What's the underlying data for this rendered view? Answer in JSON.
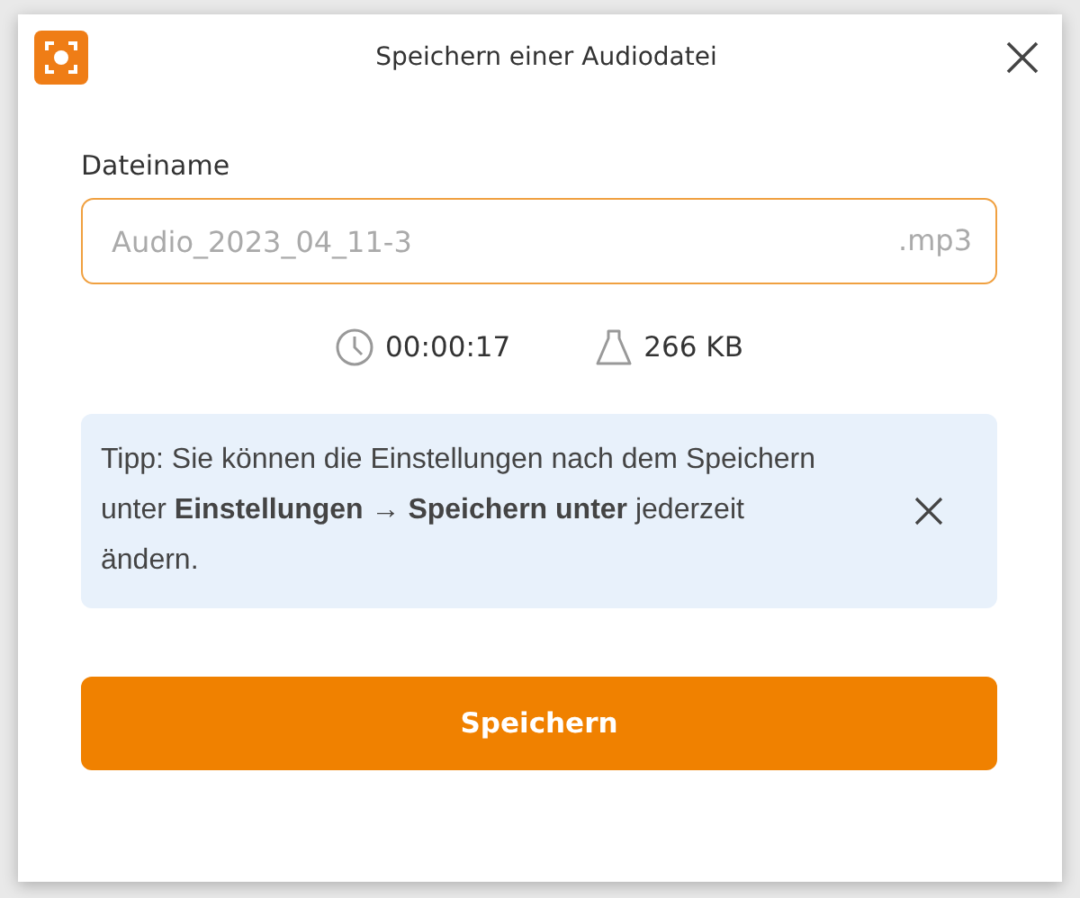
{
  "window": {
    "title": "Speichern einer Audiodatei"
  },
  "filename": {
    "label": "Dateiname",
    "placeholder": "Audio_2023_04_11-3",
    "extension": ".mp3"
  },
  "info": {
    "duration": "00:00:17",
    "size": "266 KB"
  },
  "tip": {
    "text": "Tipp: Sie können die Einstellungen nach dem Speichern unter **Einstellungen → Speichern unter** jederzeit ändern."
  },
  "buttons": [
    "Speichern"
  ]
}
